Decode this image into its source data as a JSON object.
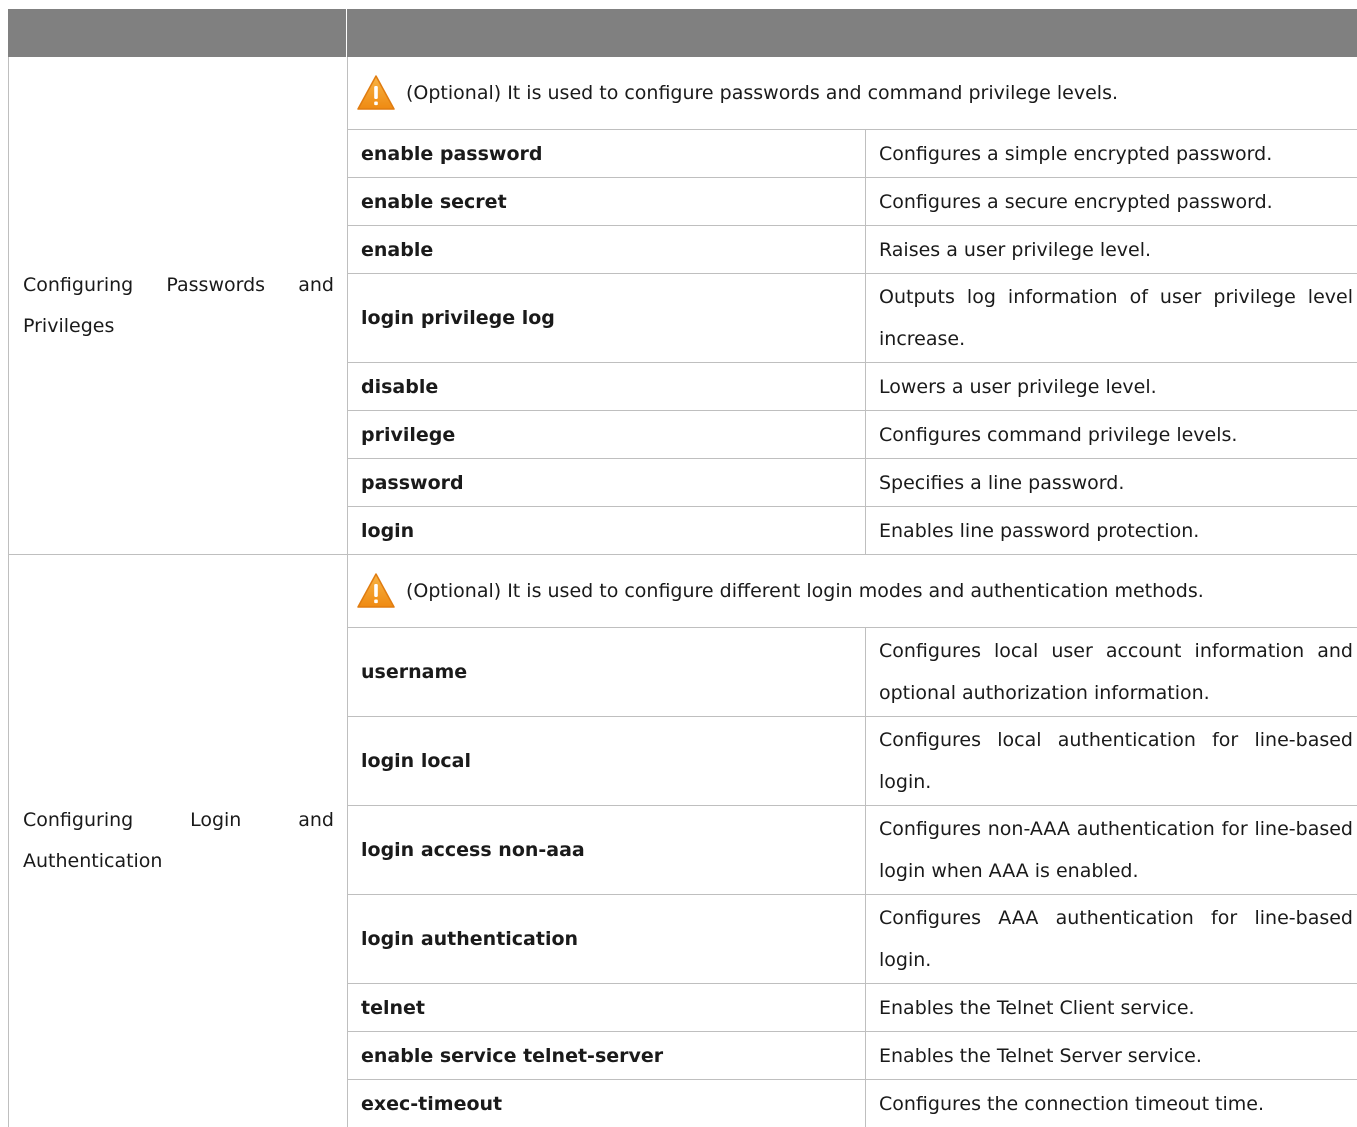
{
  "header": {
    "col1": "",
    "col2": ""
  },
  "sections": [
    {
      "title": "Configuring Passwords and Privileges",
      "note": "(Optional) It is used to configure passwords and command privilege levels.",
      "rows": [
        {
          "cmd": "enable password",
          "desc": "Configures a simple encrypted password."
        },
        {
          "cmd": "enable secret",
          "desc": "Configures a secure encrypted password."
        },
        {
          "cmd": "enable",
          "desc": "Raises a user privilege level."
        },
        {
          "cmd": "login privilege log",
          "desc": "Outputs log information of user privilege level increase."
        },
        {
          "cmd": "disable",
          "desc": "Lowers a user privilege level."
        },
        {
          "cmd": "privilege",
          "desc": "Configures command privilege levels."
        },
        {
          "cmd": "password",
          "desc": "Specifies a line password."
        },
        {
          "cmd": "login",
          "desc": "Enables line password protection."
        }
      ]
    },
    {
      "title": "Configuring Login and Authentication",
      "note": "(Optional) It is used to configure different login modes and authentication methods.",
      "rows": [
        {
          "cmd": "username",
          "desc": "Configures local user account information and optional authorization information."
        },
        {
          "cmd": "login local",
          "desc": "Configures local authentication for line-based login."
        },
        {
          "cmd": "login access non-aaa",
          "desc": "Configures non-AAA authentication for line-based login when AAA is enabled."
        },
        {
          "cmd": "login authentication",
          "desc": "Configures AAA authentication for line-based login."
        },
        {
          "cmd": "telnet",
          "desc": "Enables the Telnet Client service."
        },
        {
          "cmd": "enable service telnet-server",
          "desc": "Enables the Telnet Server service."
        },
        {
          "cmd": "exec-timeout",
          "desc": "Configures the connection timeout time."
        }
      ]
    }
  ],
  "icons": {
    "note_icon": "warning-icon",
    "warning_fill": "#f39a1f"
  }
}
